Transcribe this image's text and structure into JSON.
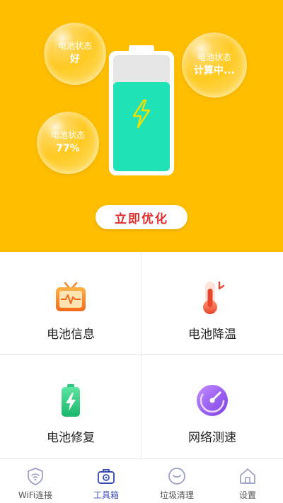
{
  "hero": {
    "bubbles": [
      {
        "label": "电池状态",
        "value": "好"
      },
      {
        "label": "电池状态",
        "value": "77%"
      },
      {
        "label": "电池状态",
        "value": "计算中..."
      }
    ],
    "battery_level_percent": 77,
    "optimize_button": "立即优化",
    "colors": {
      "background": "#ffbf00",
      "fill": "#1fe3b4",
      "button_text": "#e02e2e"
    }
  },
  "tools": [
    {
      "label": "电池信息",
      "icon": "battery-info-icon"
    },
    {
      "label": "电池降温",
      "icon": "thermometer-icon"
    },
    {
      "label": "电池修复",
      "icon": "battery-repair-icon"
    },
    {
      "label": "网络测速",
      "icon": "speedometer-icon"
    }
  ],
  "tabbar": {
    "active_index": 1,
    "active_color": "#3a4db5",
    "items": [
      {
        "label": "WiFi连接",
        "icon": "wifi-shield-icon"
      },
      {
        "label": "工具箱",
        "icon": "toolbox-icon"
      },
      {
        "label": "垃圾清理",
        "icon": "clean-icon"
      },
      {
        "label": "设置",
        "icon": "home-settings-icon"
      }
    ]
  }
}
